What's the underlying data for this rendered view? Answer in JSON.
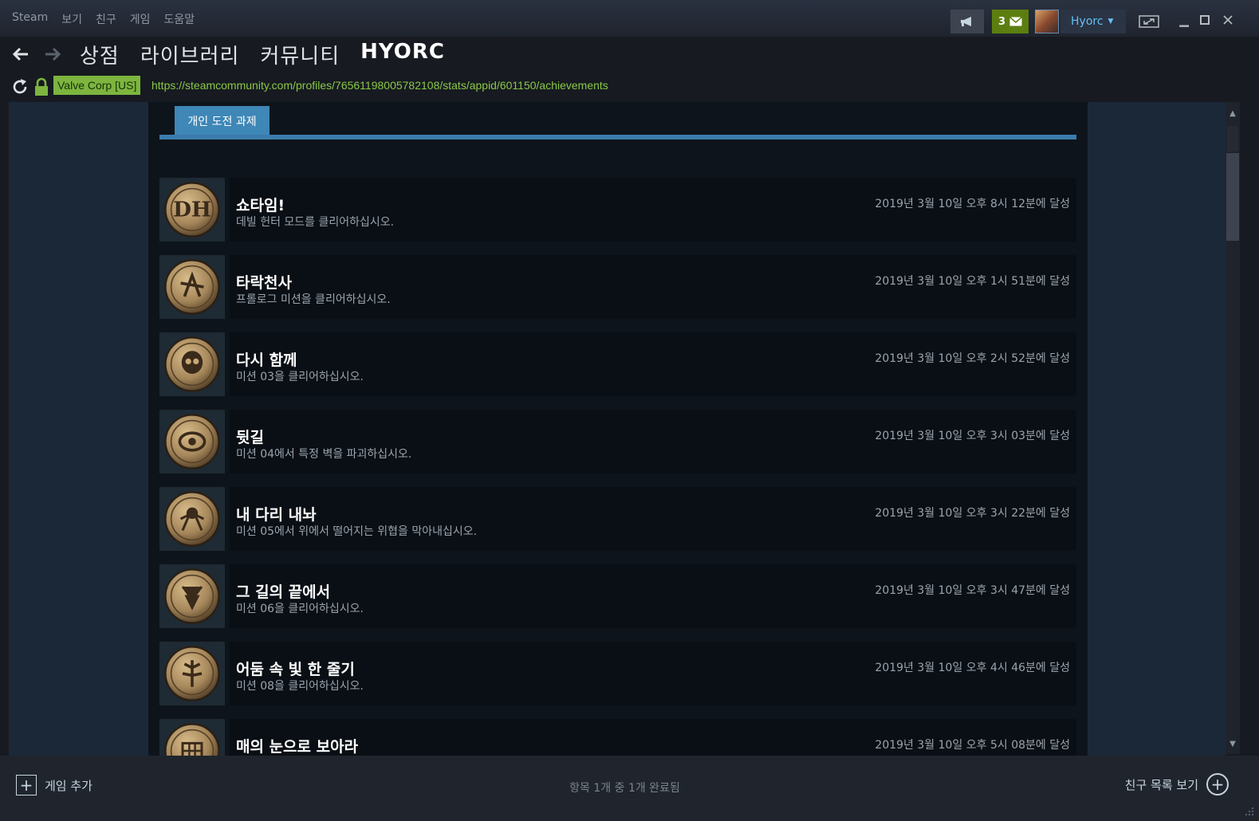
{
  "menu": {
    "items": [
      "Steam",
      "보기",
      "친구",
      "게임",
      "도움말"
    ]
  },
  "titlebar": {
    "notification_count": "3",
    "username": "Hyorc"
  },
  "nav": {
    "links": [
      "상점",
      "라이브러리",
      "커뮤니티",
      "HYORC"
    ]
  },
  "urlbar": {
    "cert": "Valve Corp [US]",
    "url": "https://steamcommunity.com/profiles/76561198005782108/stats/appid/601150/achievements"
  },
  "tab": {
    "label": "개인 도전 과제"
  },
  "achievements": [
    {
      "title": "쇼타임!",
      "desc": "데빌 헌터 모드를 클리어하십시오.",
      "date": "2019년 3월 10일 오후 8시 12분에 달성",
      "icon": "dh-emblem-icon"
    },
    {
      "title": "타락천사",
      "desc": "프롤로그 미션을 클리어하십시오.",
      "date": "2019년 3월 10일 오후 1시 51분에 달성",
      "icon": "fallen-angel-icon"
    },
    {
      "title": "다시 함께",
      "desc": "미션 03을 클리어하십시오.",
      "date": "2019년 3월 10일 오후 2시 52분에 달성",
      "icon": "skull-icon"
    },
    {
      "title": "뒷길",
      "desc": "미션 04에서 특정 벽을 파괴하십시오.",
      "date": "2019년 3월 10일 오후 3시 03분에 달성",
      "icon": "eye-gear-icon"
    },
    {
      "title": "내 다리 내놔",
      "desc": "미션 05에서 위에서 떨어지는 위협을 막아내십시오.",
      "date": "2019년 3월 10일 오후 3시 22분에 달성",
      "icon": "spider-icon"
    },
    {
      "title": "그 길의 끝에서",
      "desc": "미션 06을 클리어하십시오.",
      "date": "2019년 3월 10일 오후 3시 47분에 달성",
      "icon": "demon-icon"
    },
    {
      "title": "어둠 속 빛 한 줄기",
      "desc": "미션 08을 클리어하십시오.",
      "date": "2019년 3월 10일 오후 4시 46분에 달성",
      "icon": "tree-icon"
    },
    {
      "title": "매의 눈으로 보아라",
      "desc": "",
      "date": "2019년 3월 10일 오후 5시 08분에 달성",
      "icon": "grid-icon"
    }
  ],
  "bottombar": {
    "add_game": "게임 추가",
    "status": "항목 1개 중 1개 완료됨",
    "friends": "친구 목록 보기"
  }
}
